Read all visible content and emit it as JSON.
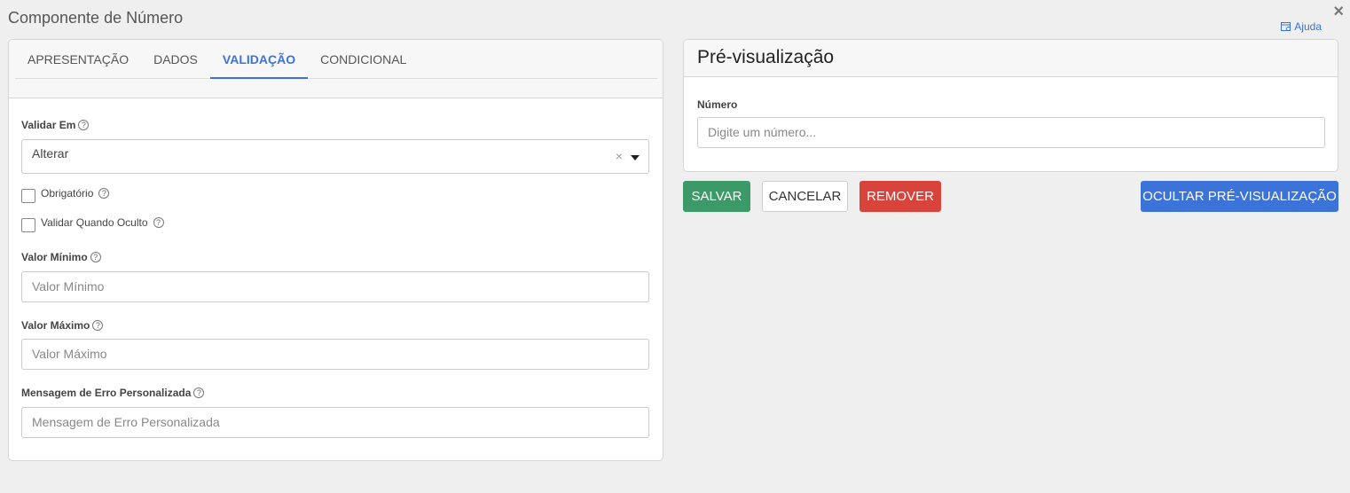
{
  "header": {
    "title": "Componente de Número",
    "help_label": "Ajuda",
    "close_symbol": "×"
  },
  "tabs": [
    {
      "label": "APRESENTAÇÃO",
      "active": false
    },
    {
      "label": "DADOS",
      "active": false
    },
    {
      "label": "VALIDAÇÃO",
      "active": true
    },
    {
      "label": "CONDICIONAL",
      "active": false
    }
  ],
  "validation": {
    "validate_on": {
      "label": "Validar Em",
      "value": "Alterar"
    },
    "required": {
      "label": "Obrigatório",
      "checked": false
    },
    "validate_hidden": {
      "label": "Validar Quando Oculto",
      "checked": false
    },
    "min_value": {
      "label": "Valor Mínimo",
      "placeholder": "Valor Mínimo"
    },
    "max_value": {
      "label": "Valor Máximo",
      "placeholder": "Valor Máximo"
    },
    "custom_error": {
      "label": "Mensagem de Erro Personalizada",
      "placeholder": "Mensagem de Erro Personalizada"
    }
  },
  "preview": {
    "title": "Pré-visualização",
    "field_label": "Número",
    "field_placeholder": "Digite um número..."
  },
  "actions": {
    "save": "SALVAR",
    "cancel": "CANCELAR",
    "remove": "REMOVER",
    "hide_preview": "OCULTAR PRÉ-VISUALIZAÇÃO"
  },
  "colors": {
    "accent": "#3b73d8",
    "save": "#3c9a68",
    "remove": "#d8433b"
  },
  "icons": {
    "help": "help-doc-icon",
    "close": "close-icon",
    "question": "question-circle-icon",
    "clear": "clear-icon",
    "caret": "caret-down-icon"
  }
}
